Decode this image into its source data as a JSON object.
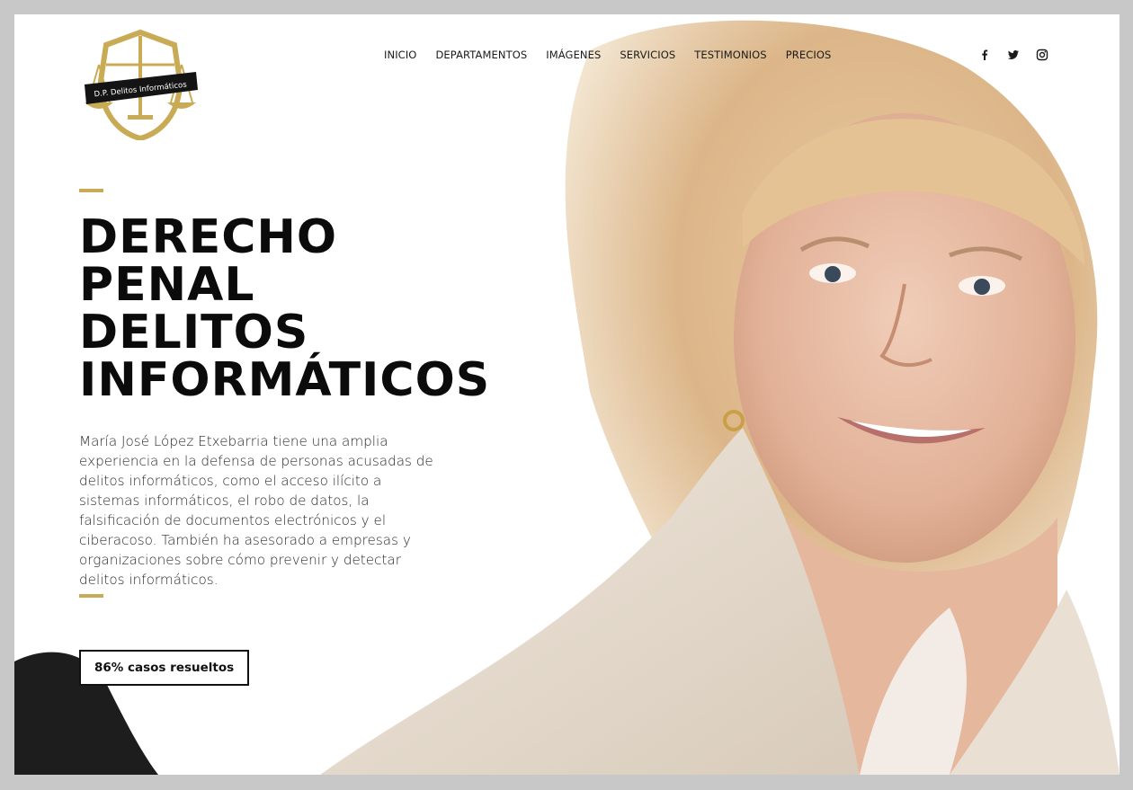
{
  "logo": {
    "text": "D.P. Delitos Informáticos"
  },
  "nav": {
    "items": [
      {
        "label": "INICIO"
      },
      {
        "label": "DEPARTAMENTOS"
      },
      {
        "label": "IMÁGENES"
      },
      {
        "label": "SERVICIOS"
      },
      {
        "label": "TESTIMONIOS"
      },
      {
        "label": "PRECIOS"
      }
    ]
  },
  "social": {
    "icons": [
      "facebook-icon",
      "twitter-icon",
      "instagram-icon"
    ]
  },
  "hero": {
    "headline": [
      "DERECHO",
      "PENAL",
      "DELITOS",
      "INFORMÁTICOS"
    ],
    "description": "María José López Etxebarria tiene una amplia experiencia en la defensa de personas acusadas de delitos informáticos, como el acceso ilícito a sistemas informáticos, el robo de datos, la falsificación de documentos electrónicos y el ciberacoso. También ha asesorado a empresas y organizaciones sobre cómo prevenir y detectar delitos informáticos.",
    "cta_label": "86% casos resueltos"
  },
  "colors": {
    "accent": "#c9ab56",
    "text": "#0b0b0b",
    "background": "#ffffff"
  }
}
